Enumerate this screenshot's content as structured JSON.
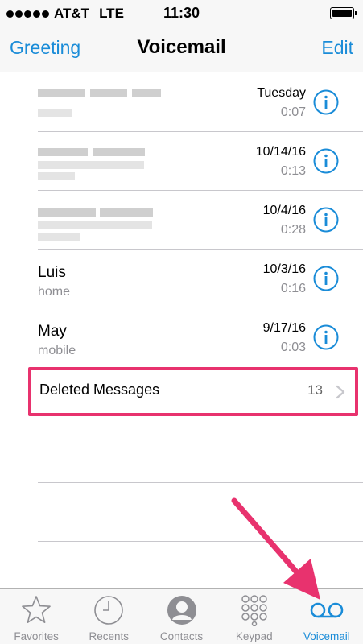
{
  "status_bar": {
    "carrier": "AT&T",
    "network": "LTE",
    "time": "11:30"
  },
  "nav": {
    "left": "Greeting",
    "title": "Voicemail",
    "right": "Edit"
  },
  "voicemails": [
    {
      "name": "",
      "subtitle": "",
      "date": "Tuesday",
      "duration": "0:07",
      "redacted": true
    },
    {
      "name": "",
      "subtitle": "",
      "date": "10/14/16",
      "duration": "0:13",
      "redacted": true
    },
    {
      "name": "",
      "subtitle": "",
      "date": "10/4/16",
      "duration": "0:28",
      "redacted": true
    },
    {
      "name": "Luis",
      "subtitle": "home",
      "date": "10/3/16",
      "duration": "0:16",
      "redacted": false
    },
    {
      "name": "May",
      "subtitle": "mobile",
      "date": "9/17/16",
      "duration": "0:03",
      "redacted": false
    }
  ],
  "deleted": {
    "label": "Deleted Messages",
    "count": "13"
  },
  "tabs": [
    {
      "label": "Favorites",
      "icon": "star-icon",
      "active": false
    },
    {
      "label": "Recents",
      "icon": "clock-icon",
      "active": false
    },
    {
      "label": "Contacts",
      "icon": "contact-icon",
      "active": false
    },
    {
      "label": "Keypad",
      "icon": "keypad-icon",
      "active": false
    },
    {
      "label": "Voicemail",
      "icon": "voicemail-icon",
      "active": true
    }
  ],
  "colors": {
    "accent": "#1a8cd8",
    "highlight": "#e8326e",
    "secondary_text": "#8e8e93"
  }
}
